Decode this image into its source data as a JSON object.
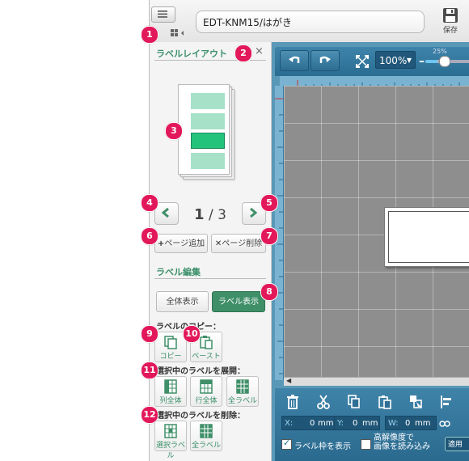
{
  "window": {
    "filename": "EDT-KNM15/はがき",
    "save_label": "保存"
  },
  "panel": {
    "title": "ラベルレイアウト",
    "close": "×",
    "page_current": "1",
    "page_sep": "/",
    "page_total": "3",
    "add_page": "ページ追加",
    "delete_page": "ページ削除",
    "edit_section": "ラベル編集",
    "show_all": "全体表示",
    "show_label": "ラベル表示",
    "copy_section": "ラベルのコピー：",
    "copy": "コピー",
    "paste": "ペースト",
    "expand_section": "選択中のラベルを展開：",
    "expand_col": "列全体",
    "expand_row": "行全体",
    "expand_all": "全ラベル",
    "delete_section": "選択中のラベルを削除：",
    "delete_selected": "選択ラベル",
    "delete_all": "全ラベル"
  },
  "toolbar": {
    "zoom": "100%",
    "zoom_slider_pct": "25%",
    "zoom_slider_value": 0.25
  },
  "bottom": {
    "x_label": "X:",
    "x_value": "0",
    "x_unit": "mm",
    "y_label": "Y:",
    "y_value": "0",
    "y_unit": "mm",
    "w_label": "W:",
    "w_value": "0",
    "w_unit": "mm",
    "show_frame": "ラベル枠を表示",
    "hires_line1": "高解像度で",
    "hires_line2": "画像を読み込み",
    "apply": "適用"
  },
  "badges": [
    "1",
    "2",
    "3",
    "4",
    "5",
    "6",
    "7",
    "8",
    "9",
    "10",
    "11",
    "12"
  ],
  "colors": {
    "accent": "#3f8f68",
    "badge": "#e2185a",
    "work": "#2b6a8f"
  }
}
